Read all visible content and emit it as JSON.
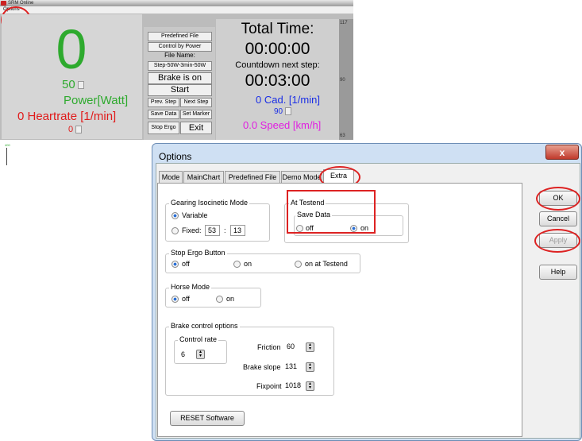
{
  "srm": {
    "title": "SRM Online",
    "menu_options": "Options",
    "big_value": "0",
    "power_value": "50",
    "power_label": "Power[Watt]",
    "heartrate_label": "0 Heartrate [1/min]",
    "heartrate_value": "0",
    "predefined_file": "Predefined File",
    "control_by_power": "Control by Power",
    "file_name_label": "File Name:",
    "file_name_value": "Step-50W-3min-50W",
    "brake_status": "Brake is on",
    "start": "Start",
    "prev_step": "Prev. Step",
    "next_step": "Next Step",
    "save_data": "Save Data",
    "set_marker": "Set Marker",
    "stop_ergo": "Stop Ergo",
    "exit": "Exit",
    "total_time_label": "Total Time:",
    "total_time_value": "00:00:00",
    "countdown_label": "Countdown next step:",
    "countdown_value": "00:03:00",
    "cadence": "0 Cad. [1/min]",
    "cadence_value": "90",
    "speed": "0.0 Speed [km/h]",
    "scale_top": "117",
    "scale_mid": "90",
    "scale_bottom": "63",
    "side_tick": "400"
  },
  "dialog": {
    "title": "Options",
    "close": "x",
    "tabs": [
      "Mode",
      "MainChart",
      "Predefined File",
      "Demo Mode",
      "Extra"
    ],
    "gearing": {
      "label": "Gearing Isocinetic Mode",
      "variable": "Variable",
      "fixed": "Fixed:",
      "front": "53",
      "sep": ":",
      "rear": "13"
    },
    "at_testend": {
      "label": "At Testend",
      "save_data": "Save Data",
      "off": "off",
      "on": "on"
    },
    "stop_ergo": {
      "label": "Stop Ergo Button",
      "off": "off",
      "on": "on",
      "on_testend": "on at Testend"
    },
    "horse": {
      "label": "Horse Mode",
      "off": "off",
      "on": "on"
    },
    "brake": {
      "label": "Brake control options",
      "control_rate_label": "Control rate",
      "control_rate": "6",
      "friction_label": "Friction",
      "friction": "60",
      "slope_label": "Brake slope",
      "slope": "131",
      "fixpoint_label": "Fixpoint",
      "fixpoint": "1018"
    },
    "reset": "RESET Software",
    "buttons": {
      "ok": "OK",
      "cancel": "Cancel",
      "apply": "Apply",
      "help": "Help"
    }
  },
  "colors": {
    "green": "#2eaa2e",
    "red": "#e01b1b",
    "blue": "#1a2ee6",
    "magenta": "#e020e0",
    "annotation": "#dd2222"
  }
}
